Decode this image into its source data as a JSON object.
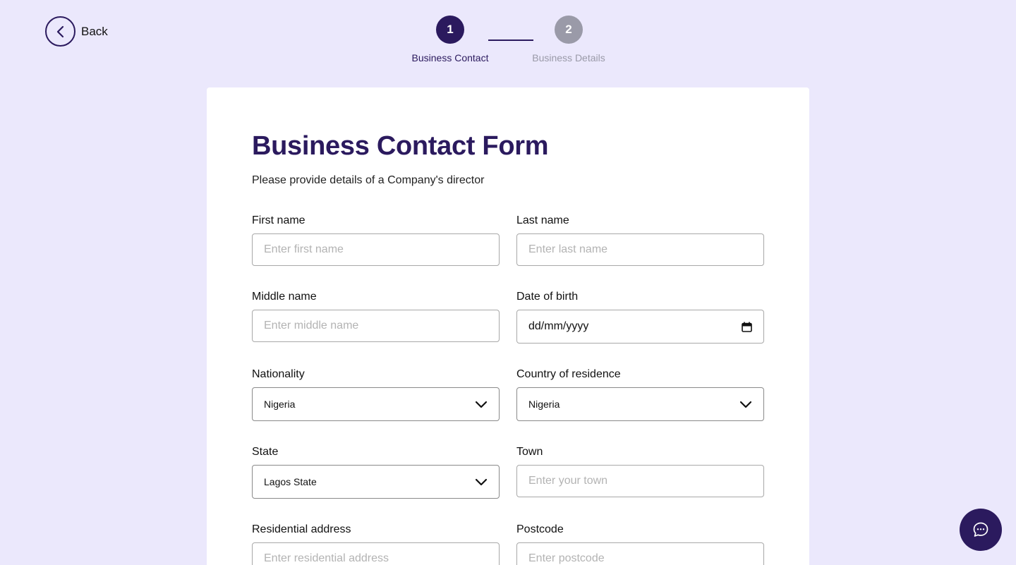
{
  "nav": {
    "back_label": "Back"
  },
  "stepper": {
    "steps": [
      {
        "number": "1",
        "label": "Business Contact",
        "state": "active"
      },
      {
        "number": "2",
        "label": "Business Details",
        "state": "inactive"
      }
    ]
  },
  "form": {
    "title": "Business Contact Form",
    "subtitle": "Please provide details of a Company's director",
    "fields": {
      "first_name": {
        "label": "First name",
        "placeholder": "Enter first name"
      },
      "last_name": {
        "label": "Last name",
        "placeholder": "Enter last name"
      },
      "middle_name": {
        "label": "Middle name",
        "placeholder": "Enter middle name"
      },
      "date_of_birth": {
        "label": "Date of birth",
        "value": "dd/mm/yyyy"
      },
      "nationality": {
        "label": "Nationality",
        "value": "Nigeria"
      },
      "country_of_residence": {
        "label": "Country of residence",
        "value": "Nigeria"
      },
      "state": {
        "label": "State",
        "value": "Lagos State"
      },
      "town": {
        "label": "Town",
        "placeholder": "Enter your town"
      },
      "residential_address": {
        "label": "Residential address",
        "placeholder": "Enter residential address"
      },
      "postcode": {
        "label": "Postcode",
        "placeholder": "Enter postcode"
      }
    }
  },
  "icons": {
    "back": "chevron-left-icon",
    "select": "chevron-down-icon",
    "calendar": "calendar-icon",
    "chat": "chat-bubble-icon"
  },
  "colors": {
    "page_background": "#ebe8fc",
    "brand": "#2b1a5e",
    "inactive_step": "#9a9aa8",
    "placeholder": "#b3b3b3"
  }
}
